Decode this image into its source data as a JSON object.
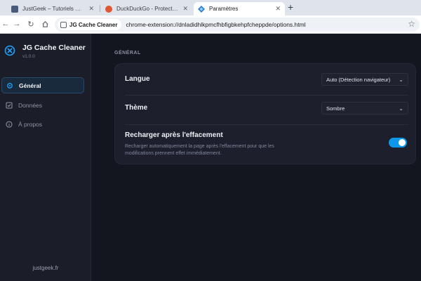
{
  "browser": {
    "tabs": [
      {
        "title": "JustGeek – Tutoriels Windows, Linux…",
        "active": false,
        "favicon_color": "#4a5a7a"
      },
      {
        "title": "DuckDuckGo - Protection. Privacy simplified",
        "active": false,
        "favicon_color": "#de5833"
      },
      {
        "title": "Paramètres",
        "active": true,
        "favicon_color": "#2b82d9"
      }
    ],
    "new_tab_symbol": "+",
    "chip_label": "JG Cache Cleaner",
    "url": "chrome-extension://dnladidhlkpmcfhbfigbkehpfcheppde/options.html"
  },
  "sidebar": {
    "app_name": "JG Cache Cleaner",
    "version": "v1.0.0",
    "items": [
      {
        "label": "Général",
        "icon": "gear-icon",
        "active": true
      },
      {
        "label": "Données",
        "icon": "checkbox-icon",
        "active": false
      },
      {
        "label": "À propos",
        "icon": "info-icon",
        "active": false
      }
    ],
    "footer": "justgeek.fr"
  },
  "main": {
    "section_title": "GÉNÉRAL",
    "language": {
      "label": "Langue",
      "value": "Auto (Détection navigateur)"
    },
    "theme": {
      "label": "Thème",
      "value": "Sombre"
    },
    "reload": {
      "label": "Recharger après l'effacement",
      "description": "Recharger automatiquement la page après l'effacement pour que les modifications prennent effet immédiatement.",
      "enabled": true
    }
  },
  "colors": {
    "accent": "#0d97ea",
    "sidebar_bg": "#1b1e29",
    "page_bg": "#14161f",
    "card_bg": "#1d202c"
  }
}
